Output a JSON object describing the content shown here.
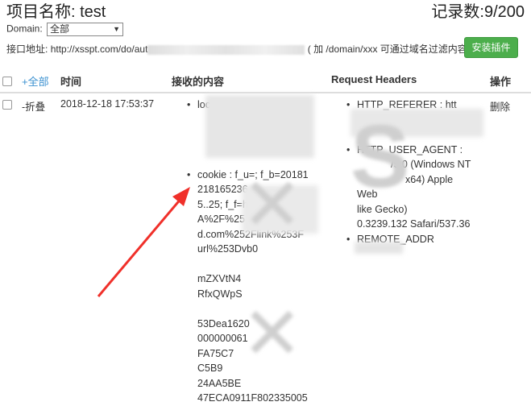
{
  "header": {
    "project_title": "项目名称: test",
    "records": "记录数:9/200"
  },
  "domain_filter": {
    "label": "Domain:",
    "selected": "全部"
  },
  "api": {
    "label": "接口地址:",
    "url_start": "http://xsspt.com/do/aut",
    "hint": "( 加 /domain/xxx 可通过域名过滤内容)"
  },
  "install_button": "安装插件",
  "table": {
    "columns": {
      "all": "+全部",
      "time": "时间",
      "content": "接收的内容",
      "headers": "Request Headers",
      "actions": "操作"
    },
    "rows": [
      {
        "toggle": "-折叠",
        "time": "2018-12-18 17:53:37",
        "content_items": [
          {
            "key": "location",
            "lines": []
          },
          {
            "key": "cookie : f_u=; f_b=20181",
            "lines": [
              "218165236",
              "5..25; f_f=https%253",
              "A%2F%25",
              "d.com%252Flink%253F",
              "url%253Dvb0",
              "mZXVtN4",
              "RfxQWpS",
              "53Dea1620",
              "000000061",
              "FA75C7",
              "C5B9",
              "24AA5BE",
              "47ECA0911F802335005"
            ]
          }
        ],
        "header_items": [
          {
            "key": "HTTP_REFERER : htt",
            "lines": []
          },
          {
            "key": "HTTP_USER_AGENT :",
            "lines": [
              "/5.0 (Windows NT",
              "x64) Apple",
              "Web",
              "like Gecko)",
              "0.3239.132 Safari/537.36"
            ]
          },
          {
            "key": "REMOTE_ADDR",
            "lines": []
          }
        ],
        "action": "删除"
      }
    ]
  }
}
